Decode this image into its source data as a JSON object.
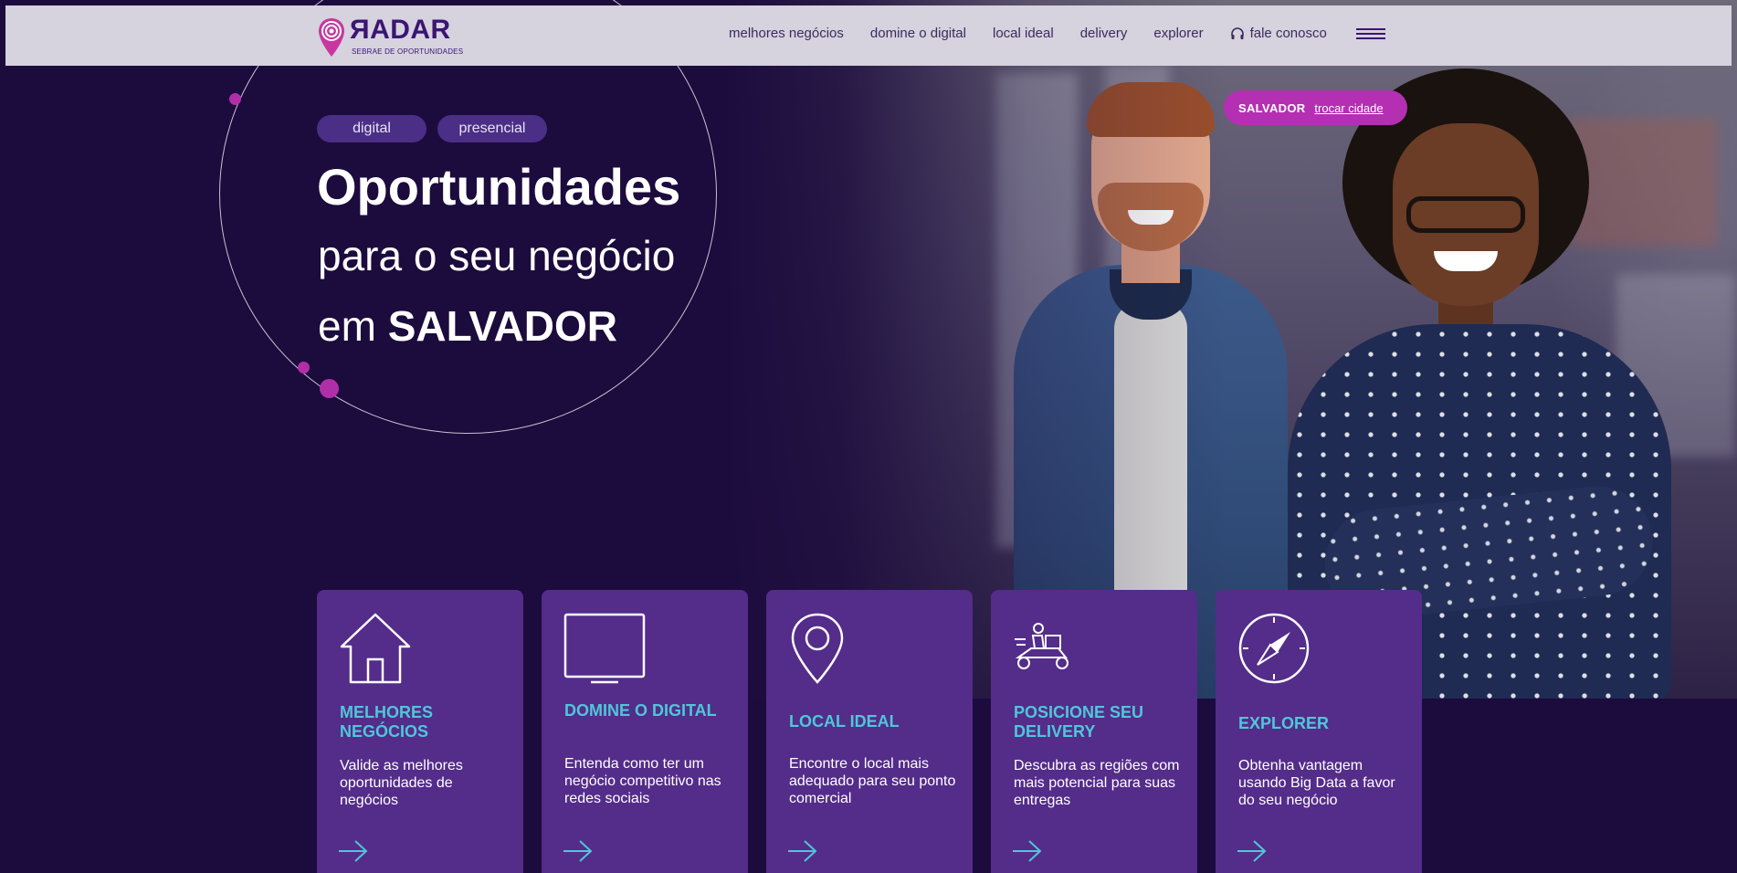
{
  "brand": {
    "name": "ЯADAR",
    "tagline": "SEBRAE DE OPORTUNIDADES",
    "accent": "#b52fb2",
    "primary": "#3b1573",
    "card_title_color": "#4fc7d8"
  },
  "nav": {
    "links": [
      "melhores negócios",
      "domine o digital",
      "local ideal",
      "delivery",
      "explorer"
    ],
    "contact_label": "fale conosco",
    "contact_icon": "headset-icon",
    "menu_icon": "hamburger-menu-icon"
  },
  "city": {
    "name": "SALVADOR",
    "change_label": "trocar cidade"
  },
  "hero": {
    "chips": [
      "digital",
      "presencial"
    ],
    "headline": "Oportunidades",
    "line1": "para o seu negócio",
    "line2_prefix": "em ",
    "line2_city": "SALVADOR"
  },
  "cards": [
    {
      "title": "MELHORES NEGÓCIOS",
      "description": "Valide as melhores oportunidades de negócios",
      "icon": "house-icon"
    },
    {
      "title": "DOMINE O DIGITAL",
      "description": "Entenda como ter um negócio competitivo nas redes sociais",
      "icon": "monitor-icon"
    },
    {
      "title": "LOCAL IDEAL",
      "description": "Encontre o local mais adequado para seu ponto comercial",
      "icon": "location-pin-icon"
    },
    {
      "title": "POSICIONE SEU DELIVERY",
      "description": "Descubra as regiões com mais potencial para suas entregas",
      "icon": "delivery-scooter-icon"
    },
    {
      "title": "EXPLORER",
      "description": "Obtenha vantagem usando Big Data a favor do seu negócio",
      "icon": "compass-icon"
    }
  ]
}
